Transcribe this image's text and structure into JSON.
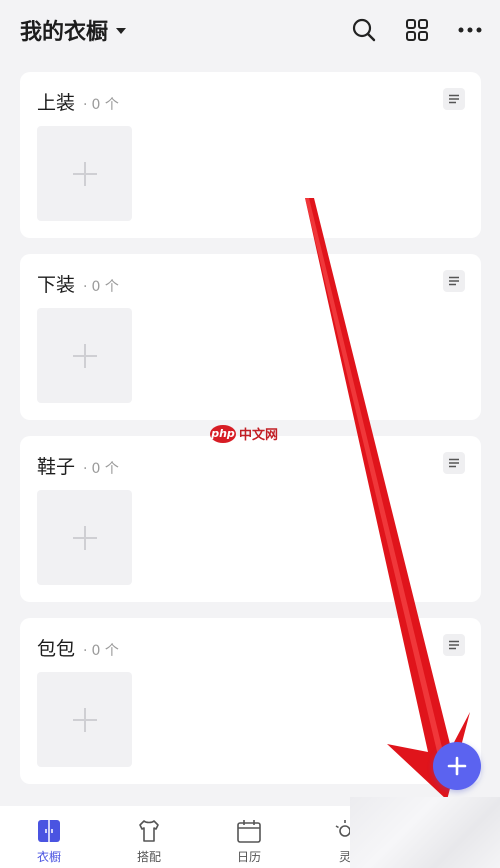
{
  "header": {
    "title": "我的衣橱",
    "icons": [
      "search-icon",
      "grid-icon",
      "more-icon"
    ]
  },
  "categories": [
    {
      "name": "上装",
      "dot": "·",
      "count": "0 个"
    },
    {
      "name": "下装",
      "dot": "·",
      "count": "0 个"
    },
    {
      "name": "鞋子",
      "dot": "·",
      "count": "0 个"
    },
    {
      "name": "包包",
      "dot": "·",
      "count": "0 个"
    }
  ],
  "watermark": {
    "logo": "php",
    "text": "中文网"
  },
  "bottom_nav": [
    {
      "label": "衣橱",
      "icon": "wardrobe-icon",
      "active": true
    },
    {
      "label": "搭配",
      "icon": "outfit-icon",
      "active": false
    },
    {
      "label": "日历",
      "icon": "calendar-icon",
      "active": false
    },
    {
      "label": "灵",
      "icon": "inspiration-icon",
      "active": false
    }
  ],
  "colors": {
    "accent": "#5b63f0",
    "nav_active": "#4a54e1",
    "background": "#f3f3f5",
    "arrow": "#e0141b"
  }
}
